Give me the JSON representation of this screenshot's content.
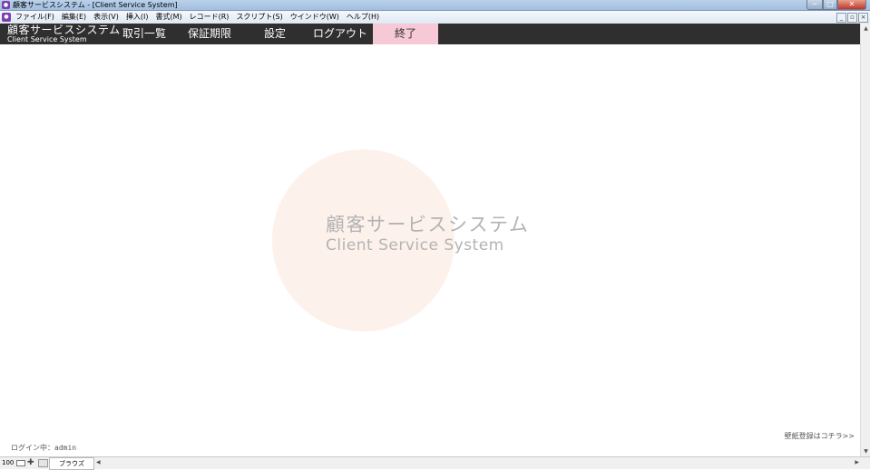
{
  "window": {
    "title": "顧客サービスシステム - [Client Service System]",
    "app_icon": "filemaker-icon"
  },
  "menubar": {
    "items": [
      "ファイル(F)",
      "編集(E)",
      "表示(V)",
      "挿入(I)",
      "書式(M)",
      "レコード(R)",
      "スクリプト(S)",
      "ウインドウ(W)",
      "ヘルプ(H)"
    ]
  },
  "nav": {
    "brand_jp": "顧客サービスシステム",
    "brand_en": "Client Service System",
    "items": [
      "取引一覧",
      "保証期限",
      "設定",
      "ログアウト",
      "終了"
    ],
    "active_color": "#f7c9d6",
    "bar_color": "#2f2f2f"
  },
  "main": {
    "logo_jp": "顧客サービスシステム",
    "logo_en": "Client Service System",
    "wallpaper_link": "壁紙登録はコチラ>>",
    "login_status": "ログイン中：admin"
  },
  "statusbar": {
    "zoom": "100",
    "mode": "ブラウズ"
  }
}
